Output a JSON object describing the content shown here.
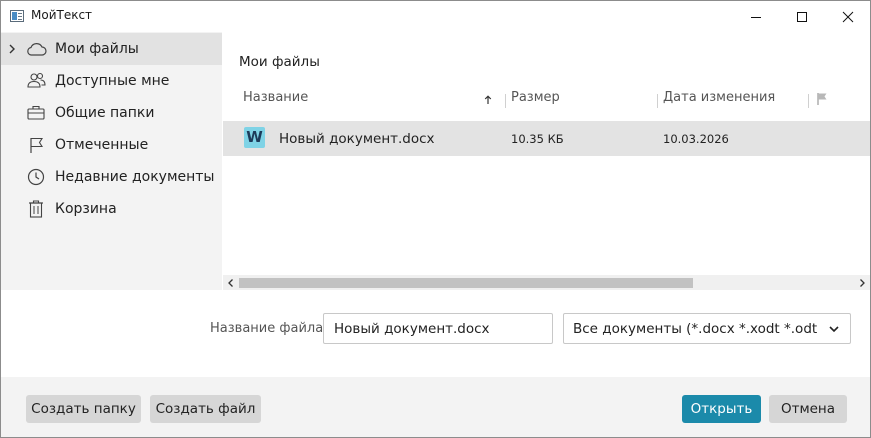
{
  "window": {
    "title": "МойТекст"
  },
  "sidebar": {
    "items": [
      {
        "label": "Мои файлы",
        "icon": "cloud-icon",
        "active": true
      },
      {
        "label": "Доступные мне",
        "icon": "users-icon",
        "active": false
      },
      {
        "label": "Общие папки",
        "icon": "briefcase-icon",
        "active": false
      },
      {
        "label": "Отмеченные",
        "icon": "flag-icon",
        "active": false
      },
      {
        "label": "Недавние документы",
        "icon": "clock-icon",
        "active": false
      },
      {
        "label": "Корзина",
        "icon": "trash-icon",
        "active": false
      }
    ]
  },
  "main": {
    "title": "Мои файлы",
    "columns": {
      "name": "Название",
      "size": "Размер",
      "date": "Дата изменения"
    },
    "files": [
      {
        "name": "Новый документ.docx",
        "size": "10.35 КБ",
        "date": "10.03.2026",
        "icon": "word-document-icon"
      }
    ]
  },
  "file_form": {
    "filename_label": "Название файла",
    "filename_value": "Новый документ.docx",
    "filetype_value": "Все документы (*.docx *.xodt *.odt *.t..."
  },
  "buttons": {
    "create_folder": "Создать папку",
    "create_file": "Создать файл",
    "open": "Открыть",
    "cancel": "Отмена"
  },
  "colors": {
    "accent": "#1b8aaa",
    "sidebar_bg": "#f3f3f3",
    "selected_row": "#e3e3e3",
    "word_icon": "#7fd3e6"
  }
}
